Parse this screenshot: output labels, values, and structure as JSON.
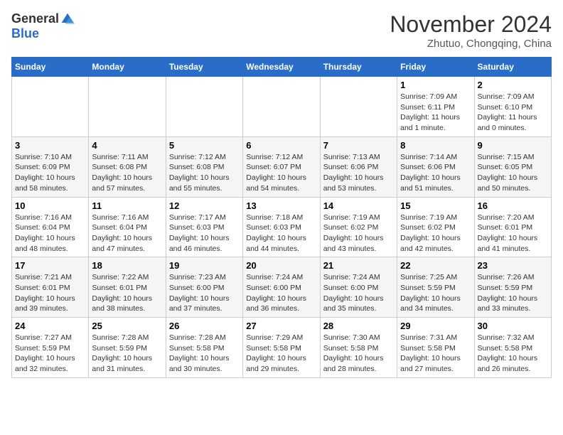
{
  "header": {
    "logo_general": "General",
    "logo_blue": "Blue",
    "month_title": "November 2024",
    "location": "Zhutuo, Chongqing, China"
  },
  "days_of_week": [
    "Sunday",
    "Monday",
    "Tuesday",
    "Wednesday",
    "Thursday",
    "Friday",
    "Saturday"
  ],
  "weeks": [
    [
      {
        "day": "",
        "info": ""
      },
      {
        "day": "",
        "info": ""
      },
      {
        "day": "",
        "info": ""
      },
      {
        "day": "",
        "info": ""
      },
      {
        "day": "",
        "info": ""
      },
      {
        "day": "1",
        "info": "Sunrise: 7:09 AM\nSunset: 6:11 PM\nDaylight: 11 hours and 1 minute."
      },
      {
        "day": "2",
        "info": "Sunrise: 7:09 AM\nSunset: 6:10 PM\nDaylight: 11 hours and 0 minutes."
      }
    ],
    [
      {
        "day": "3",
        "info": "Sunrise: 7:10 AM\nSunset: 6:09 PM\nDaylight: 10 hours and 58 minutes."
      },
      {
        "day": "4",
        "info": "Sunrise: 7:11 AM\nSunset: 6:08 PM\nDaylight: 10 hours and 57 minutes."
      },
      {
        "day": "5",
        "info": "Sunrise: 7:12 AM\nSunset: 6:08 PM\nDaylight: 10 hours and 55 minutes."
      },
      {
        "day": "6",
        "info": "Sunrise: 7:12 AM\nSunset: 6:07 PM\nDaylight: 10 hours and 54 minutes."
      },
      {
        "day": "7",
        "info": "Sunrise: 7:13 AM\nSunset: 6:06 PM\nDaylight: 10 hours and 53 minutes."
      },
      {
        "day": "8",
        "info": "Sunrise: 7:14 AM\nSunset: 6:06 PM\nDaylight: 10 hours and 51 minutes."
      },
      {
        "day": "9",
        "info": "Sunrise: 7:15 AM\nSunset: 6:05 PM\nDaylight: 10 hours and 50 minutes."
      }
    ],
    [
      {
        "day": "10",
        "info": "Sunrise: 7:16 AM\nSunset: 6:04 PM\nDaylight: 10 hours and 48 minutes."
      },
      {
        "day": "11",
        "info": "Sunrise: 7:16 AM\nSunset: 6:04 PM\nDaylight: 10 hours and 47 minutes."
      },
      {
        "day": "12",
        "info": "Sunrise: 7:17 AM\nSunset: 6:03 PM\nDaylight: 10 hours and 46 minutes."
      },
      {
        "day": "13",
        "info": "Sunrise: 7:18 AM\nSunset: 6:03 PM\nDaylight: 10 hours and 44 minutes."
      },
      {
        "day": "14",
        "info": "Sunrise: 7:19 AM\nSunset: 6:02 PM\nDaylight: 10 hours and 43 minutes."
      },
      {
        "day": "15",
        "info": "Sunrise: 7:19 AM\nSunset: 6:02 PM\nDaylight: 10 hours and 42 minutes."
      },
      {
        "day": "16",
        "info": "Sunrise: 7:20 AM\nSunset: 6:01 PM\nDaylight: 10 hours and 41 minutes."
      }
    ],
    [
      {
        "day": "17",
        "info": "Sunrise: 7:21 AM\nSunset: 6:01 PM\nDaylight: 10 hours and 39 minutes."
      },
      {
        "day": "18",
        "info": "Sunrise: 7:22 AM\nSunset: 6:01 PM\nDaylight: 10 hours and 38 minutes."
      },
      {
        "day": "19",
        "info": "Sunrise: 7:23 AM\nSunset: 6:00 PM\nDaylight: 10 hours and 37 minutes."
      },
      {
        "day": "20",
        "info": "Sunrise: 7:24 AM\nSunset: 6:00 PM\nDaylight: 10 hours and 36 minutes."
      },
      {
        "day": "21",
        "info": "Sunrise: 7:24 AM\nSunset: 6:00 PM\nDaylight: 10 hours and 35 minutes."
      },
      {
        "day": "22",
        "info": "Sunrise: 7:25 AM\nSunset: 5:59 PM\nDaylight: 10 hours and 34 minutes."
      },
      {
        "day": "23",
        "info": "Sunrise: 7:26 AM\nSunset: 5:59 PM\nDaylight: 10 hours and 33 minutes."
      }
    ],
    [
      {
        "day": "24",
        "info": "Sunrise: 7:27 AM\nSunset: 5:59 PM\nDaylight: 10 hours and 32 minutes."
      },
      {
        "day": "25",
        "info": "Sunrise: 7:28 AM\nSunset: 5:59 PM\nDaylight: 10 hours and 31 minutes."
      },
      {
        "day": "26",
        "info": "Sunrise: 7:28 AM\nSunset: 5:58 PM\nDaylight: 10 hours and 30 minutes."
      },
      {
        "day": "27",
        "info": "Sunrise: 7:29 AM\nSunset: 5:58 PM\nDaylight: 10 hours and 29 minutes."
      },
      {
        "day": "28",
        "info": "Sunrise: 7:30 AM\nSunset: 5:58 PM\nDaylight: 10 hours and 28 minutes."
      },
      {
        "day": "29",
        "info": "Sunrise: 7:31 AM\nSunset: 5:58 PM\nDaylight: 10 hours and 27 minutes."
      },
      {
        "day": "30",
        "info": "Sunrise: 7:32 AM\nSunset: 5:58 PM\nDaylight: 10 hours and 26 minutes."
      }
    ]
  ]
}
